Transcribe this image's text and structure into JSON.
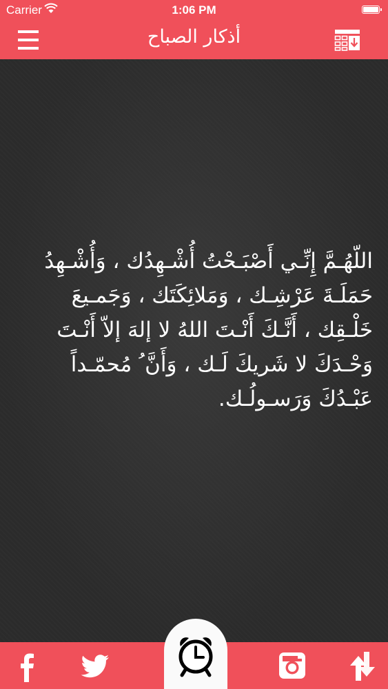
{
  "status_bar": {
    "carrier": "Carrier",
    "time": "1:06 PM"
  },
  "header": {
    "title": "أذكار الصباح",
    "left_icon": "menu-icon",
    "right_icon": "list-download-icon"
  },
  "main": {
    "dhikr_text": "اللّهُـمَّ إِنِّـي أَصْبَـحْتُ أُشْـهِدُك ، وَأُشْـهِدُ حَمَلَـةَ عَرْشِـك ، وَمَلائِكَتَك ، وَجَمـيعَ خَلْـقِك ، أَنَّـكَ أَنْـتَ اللهُ لا إلهَ إلاّ أَنْـتَ وَحْـدَكَ لا شَريكَ لَـك ، وَأَنَّ ُ مُحمّـداً عَبْـدُكَ وَرَسـولُـك."
  },
  "tab_bar": {
    "items": [
      {
        "icon": "facebook-icon"
      },
      {
        "icon": "twitter-icon"
      },
      {
        "icon": "alarm-clock-icon"
      },
      {
        "icon": "instagram-icon"
      },
      {
        "icon": "share-arrows-icon"
      }
    ]
  },
  "colors": {
    "accent": "#f0505a",
    "content_background": "#2b2b2b",
    "text": "#ffffff"
  }
}
